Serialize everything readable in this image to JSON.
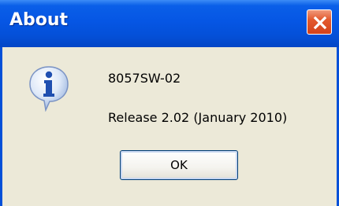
{
  "window": {
    "title": "About",
    "close_icon": "close-icon"
  },
  "message": {
    "icon": "info-icon",
    "product": "8057SW-02",
    "release": "Release 2.02 (January 2010)"
  },
  "buttons": {
    "ok_label": "OK"
  },
  "colors": {
    "titlebar": "#0450d8",
    "dialog_background": "#ece9d8",
    "close_button": "#e35a2e"
  }
}
